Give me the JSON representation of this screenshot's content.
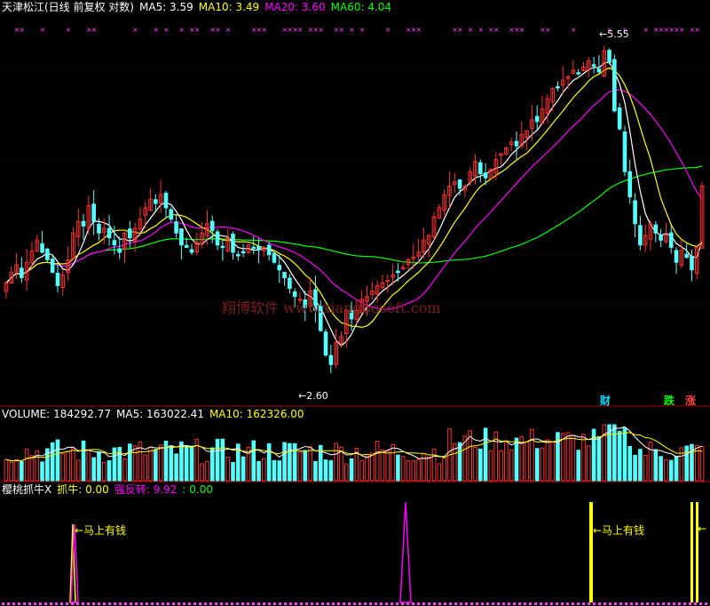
{
  "price_panel": {
    "title": "天津松江(日线 前复权 对数)",
    "ma_labels": [
      {
        "text": "MA5: 3.59",
        "color": "#ffffff"
      },
      {
        "text": "MA10: 3.49",
        "color": "#ffff00"
      },
      {
        "text": "MA20: 3.60",
        "color": "#ff00ff"
      },
      {
        "text": "MA60: 4.04",
        "color": "#00ff00"
      }
    ],
    "high_label": "5.55",
    "low_label": "2.60",
    "watermark": "翔博软件 www.xiangbosoft.com",
    "tags": [
      {
        "text": "财",
        "color": "#00e0ff"
      },
      {
        "text": "跌",
        "color": "#00ff00"
      },
      {
        "text": "涨",
        "color": "#ff4040"
      }
    ]
  },
  "volume_panel": {
    "labels": [
      {
        "text": "VOLUME: 184292.77",
        "color": "#ffffff"
      },
      {
        "text": "MA5: 163022.41",
        "color": "#ffffff"
      },
      {
        "text": "MA10: 162326.00",
        "color": "#ffff00"
      }
    ]
  },
  "indicator_panel": {
    "labels": [
      {
        "text": "樱桃抓牛X",
        "color": "#ffffff"
      },
      {
        "text": "抓牛: 0.00",
        "color": "#ffff00"
      },
      {
        "text": "强反转: 9.92",
        "color": "#ff00ff"
      },
      {
        "text": ": 0.00",
        "color": "#00ff00"
      }
    ],
    "signal_text": "←马上有钱"
  },
  "colors": {
    "up": "#ff3030",
    "down": "#54ffff",
    "ma5": "#ffffff",
    "ma10": "#ffff00",
    "ma20": "#ff00ff",
    "ma60": "#00ff00"
  },
  "chart_data": {
    "type": "candlestick",
    "y_scale": "log",
    "ylim": [
      2.5,
      5.75
    ],
    "closes": [
      3.22,
      3.3,
      3.36,
      3.26,
      3.38,
      3.47,
      3.56,
      3.46,
      3.4,
      3.3,
      3.2,
      3.28,
      3.4,
      3.62,
      3.72,
      3.68,
      3.86,
      3.72,
      3.62,
      3.66,
      3.58,
      3.52,
      3.46,
      3.62,
      3.58,
      3.66,
      3.74,
      3.84,
      3.92,
      3.88,
      3.96,
      3.84,
      3.74,
      3.62,
      3.52,
      3.5,
      3.46,
      3.54,
      3.62,
      3.7,
      3.64,
      3.52,
      3.5,
      3.58,
      3.46,
      3.44,
      3.46,
      3.52,
      3.5,
      3.48,
      3.5,
      3.44,
      3.38,
      3.32,
      3.26,
      3.18,
      3.12,
      3.1,
      3.04,
      3.16,
      3.02,
      2.88,
      2.72,
      2.66,
      2.8,
      2.84,
      3.02,
      2.96,
      3.02,
      3.1,
      3.12,
      3.16,
      3.2,
      3.22,
      3.24,
      3.28,
      3.3,
      3.34,
      3.4,
      3.42,
      3.46,
      3.56,
      3.6,
      3.76,
      3.84,
      3.96,
      4.04,
      4.08,
      4.02,
      4.04,
      4.18,
      4.28,
      4.16,
      4.12,
      4.2,
      4.3,
      4.36,
      4.42,
      4.48,
      4.44,
      4.56,
      4.6,
      4.72,
      4.7,
      4.84,
      4.96,
      5.08,
      5.1,
      5.18,
      5.22,
      5.3,
      5.26,
      5.34,
      5.42,
      5.36,
      5.28,
      5.55,
      5.4,
      4.82,
      4.62,
      4.18,
      3.94,
      3.7,
      3.52,
      3.6,
      3.7,
      3.62,
      3.56,
      3.6,
      3.5,
      3.38,
      3.48,
      3.42,
      3.32,
      3.5,
      4.04
    ]
  }
}
